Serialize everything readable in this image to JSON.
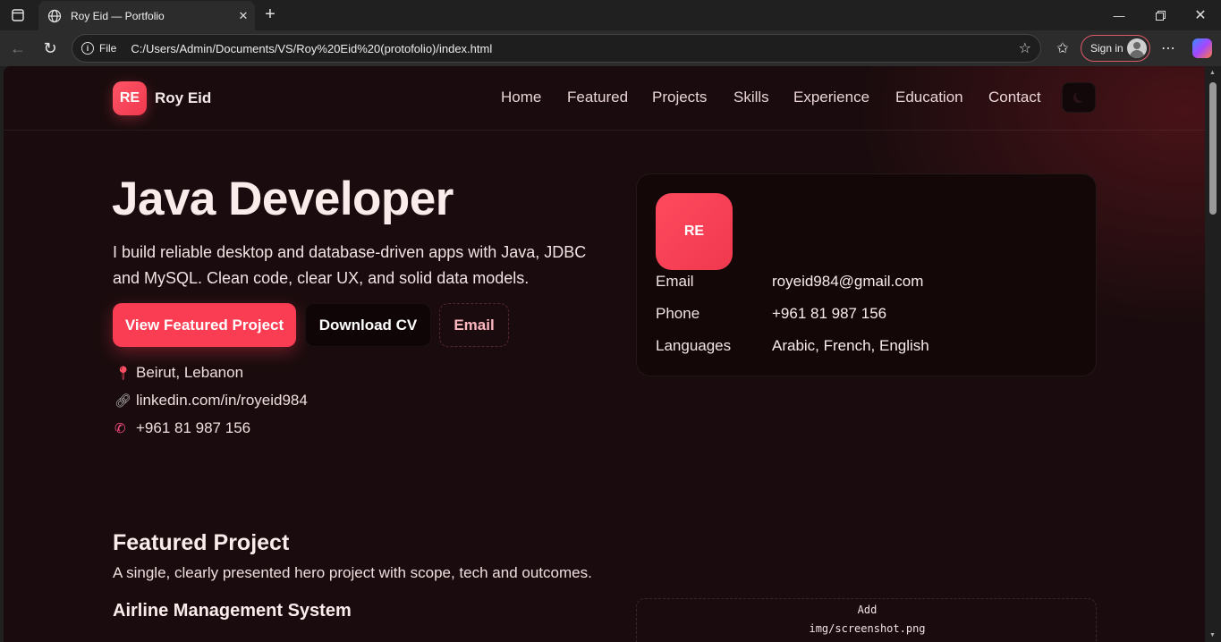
{
  "browser": {
    "tab_title": "Roy Eid — Portfolio",
    "address_label": "File",
    "url": "C:/Users/Admin/Documents/VS/Roy%20Eid%20(protofolio)/index.html",
    "sign_in_label": "Sign in"
  },
  "header": {
    "logo_initials": "RE",
    "brand_name": "Roy Eid",
    "nav": [
      "Home",
      "Featured",
      "Projects",
      "Skills",
      "Experience",
      "Education",
      "Contact"
    ]
  },
  "hero": {
    "title": "Java Developer",
    "description": "I build reliable desktop and database-driven apps with Java, JDBC and MySQL. Clean code, clear UX, and solid data models.",
    "buttons": {
      "primary": "View Featured Project",
      "download": "Download CV",
      "email": "Email"
    },
    "contacts": {
      "location": "Beirut, Lebanon",
      "linkedin": "linkedin.com/in/royeid984",
      "phone": "+961 81 987 156"
    }
  },
  "profile_card": {
    "initials": "RE",
    "rows": [
      {
        "key": "Email",
        "value": "royeid984@gmail.com"
      },
      {
        "key": "Phone",
        "value": "+961 81 987 156"
      },
      {
        "key": "Languages",
        "value": "Arabic, French, English"
      }
    ]
  },
  "featured": {
    "title": "Featured Project",
    "subtitle": "A single, clearly presented hero project with scope, tech and outcomes.",
    "project_title": "Airline Management System",
    "screenshot_placeholder_line1": "Add",
    "screenshot_placeholder_line2": "img/screenshot.png"
  },
  "colors": {
    "accent": "#fa3d52",
    "page_bg": "#1a0c0e",
    "card_bg": "#140708"
  }
}
